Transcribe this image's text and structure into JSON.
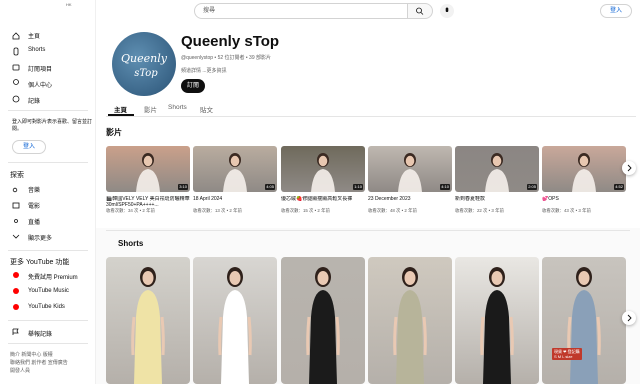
{
  "sidebar": {
    "locale_tag": "HK",
    "main_items": [
      {
        "label": "主頁",
        "icon": "home-icon"
      },
      {
        "label": "Shorts",
        "icon": "shorts-icon"
      },
      {
        "label": "訂閱項目",
        "icon": "subscriptions-icon"
      },
      {
        "label": "個人中心",
        "icon": "you-icon"
      },
      {
        "label": "記錄",
        "icon": "history-icon"
      }
    ],
    "signin_note": "登入即可對影片表示喜歡、留言並訂閱。",
    "signin_label": "登入",
    "explore_heading": "探索",
    "explore_items": [
      {
        "label": "音樂",
        "icon": "music-icon"
      },
      {
        "label": "電影",
        "icon": "movie-icon"
      },
      {
        "label": "直播",
        "icon": "live-icon"
      },
      {
        "label": "顯示更多",
        "icon": "chevron-down-icon"
      }
    ],
    "more_heading": "更多 YouTube 功能",
    "more_items": [
      {
        "label": "免費試用 Premium",
        "icon": "premium-icon"
      },
      {
        "label": "YouTube Music",
        "icon": "yt-music-icon"
      },
      {
        "label": "YouTube Kids",
        "icon": "yt-kids-icon"
      }
    ],
    "report_label": "舉報記錄",
    "footer_line1": "簡介  新聞中心  版權",
    "footer_line2": "聯絡我們  創作者  宣傳廣告",
    "footer_line3": "開發人員"
  },
  "topbar": {
    "search_placeholder": "搜尋",
    "signin_label": "登入"
  },
  "channel": {
    "name": "Queenly sTop",
    "meta": "@queenlystop • 52 位訂閱者 • 39 部影片",
    "description": "頻道詳情 ...更多資訊",
    "subscribe_label": "訂閱",
    "avatar_text_line1": "Queenly",
    "avatar_text_line2": "sTop"
  },
  "tabs": [
    {
      "label": "主頁",
      "active": true
    },
    {
      "label": "影片",
      "active": false
    },
    {
      "label": "Shorts",
      "active": false
    },
    {
      "label": "貼文",
      "active": false
    }
  ],
  "videos_section": {
    "heading": "影片",
    "items": [
      {
        "title": "🎬韓國VELY VELY 美白祛斑防曬精華30ml/SPF50+PA++++...",
        "meta": "收看次數：34 次 • 2 年前",
        "duration": "3:10",
        "bg": "#caa08a"
      },
      {
        "title": "18 April 2024",
        "meta": "收看次數：13 次 • 2 年前",
        "duration": "4:05",
        "bg": "#b9ac9f"
      },
      {
        "title": "優芯絨🍓修腿顯瘦顯高鬆叉長褲",
        "meta": "收看次數：15 次 • 2 年前",
        "duration": "1:10",
        "bg": "#6f6a5c"
      },
      {
        "title": "23 December 2023",
        "meta": "收看次數：48 次 • 2 年前",
        "duration": "4:10",
        "bg": "#bfb8b0"
      },
      {
        "title": "新到春夏鞋款",
        "meta": "收看次數：22 次 • 3 年前",
        "duration": "2:05",
        "bg": "#8b8683"
      },
      {
        "title": "💕OPS",
        "meta": "收看次數：43 次 • 3 年前",
        "duration": "4:52",
        "bg": "#c9a89a"
      }
    ]
  },
  "shorts_section": {
    "heading": "Shorts",
    "items": [
      {
        "label": "Short 1",
        "bg": "#d4d2cc"
      },
      {
        "label": "Short 2",
        "bg": "#d8d6d2"
      },
      {
        "label": "Short 3",
        "bg": "#b8b4ae"
      },
      {
        "label": "Short 4",
        "bg": "#cfc9bf"
      },
      {
        "label": "Short 5",
        "bg": "#e9e7e3"
      },
      {
        "label": "Short 6",
        "bg": "#c8c4be"
      }
    ],
    "size_badge": "現貨 ❤ 登記購\nS M L size"
  }
}
